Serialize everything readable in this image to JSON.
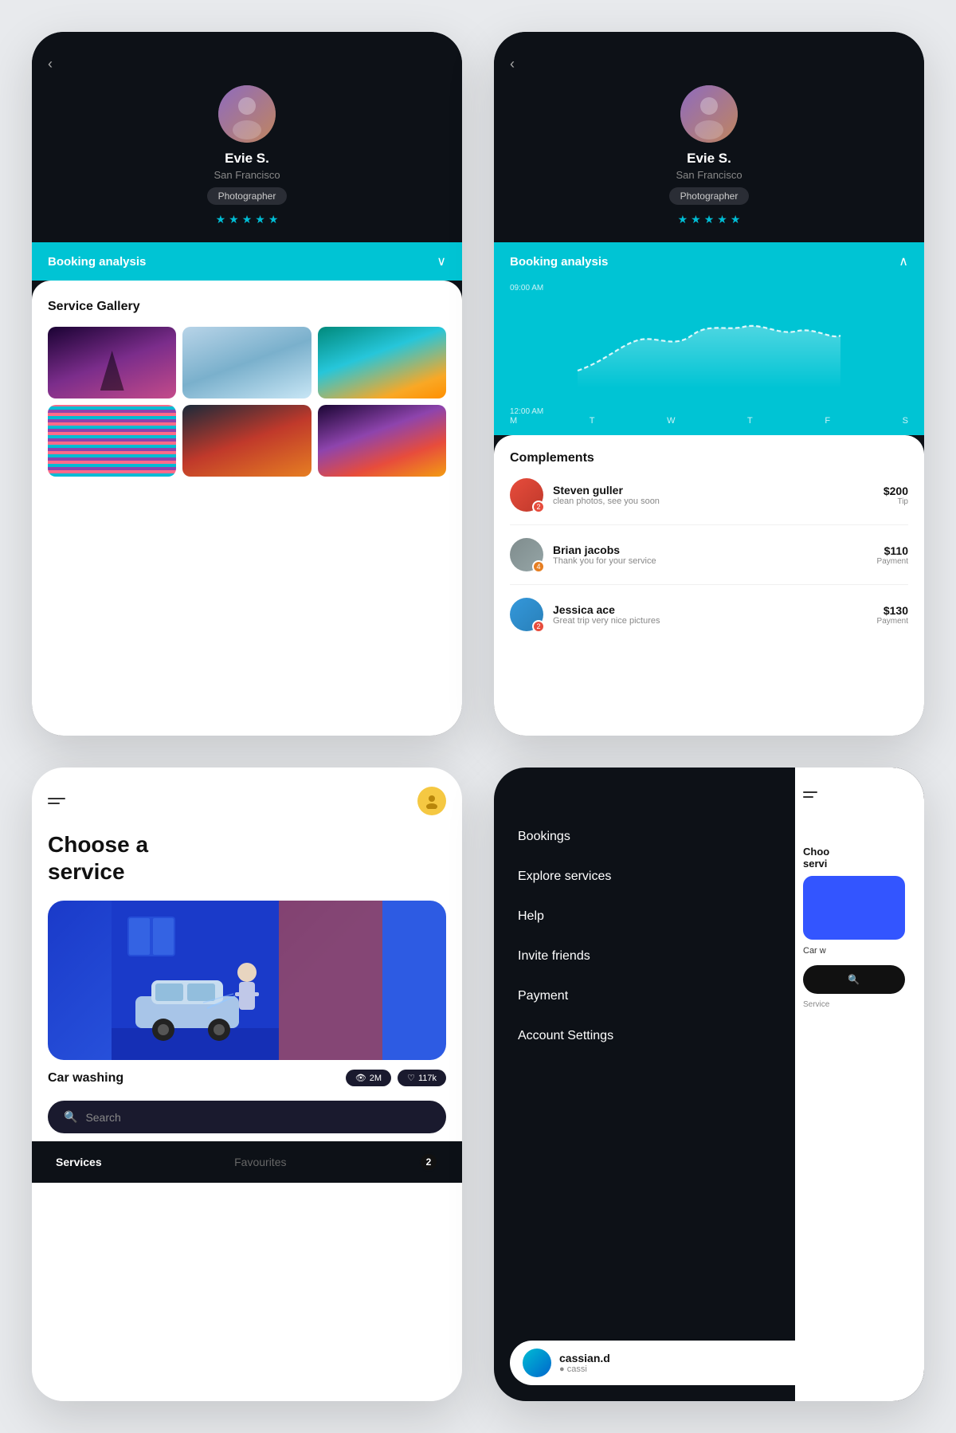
{
  "topLeft": {
    "back": "‹",
    "name": "Evie S.",
    "city": "San Francisco",
    "badge": "Photographer",
    "stars": [
      "★",
      "★",
      "★",
      "★",
      "★"
    ],
    "bookingBar": "Booking analysis",
    "chevron": "∨",
    "galleryTitle": "Service Gallery",
    "images": [
      "img1",
      "img2",
      "img3",
      "img4",
      "img5",
      "img6"
    ]
  },
  "topRight": {
    "back": "‹",
    "name": "Evie S.",
    "city": "San Francisco",
    "badge": "Photographer",
    "stars": [
      "★",
      "★",
      "★",
      "★",
      "★"
    ],
    "bookingBar": "Booking analysis",
    "chevron": "∧",
    "timeTop": "09:00 AM",
    "timeBottom": "12:00 AM",
    "days": [
      "M",
      "T",
      "W",
      "T",
      "F",
      "S"
    ],
    "complementsTitle": "Complements",
    "complements": [
      {
        "name": "Steven guller",
        "msg": "clean photos, see you soon",
        "amount": "$200",
        "type": "Tip",
        "badge": "2"
      },
      {
        "name": "Brian jacobs",
        "msg": "Thank you for your service",
        "amount": "$110",
        "type": "Payment",
        "badge": "4"
      },
      {
        "name": "Jessica ace",
        "msg": "Great trip very nice pictures",
        "amount": "$130",
        "type": "Payment",
        "badge": "2"
      }
    ]
  },
  "bottomLeft": {
    "menuIcon": "≡",
    "chooseTitle": "Choose a\nservice",
    "serviceName": "Car washing",
    "stats": [
      {
        "icon": "👁",
        "value": "2M"
      },
      {
        "icon": "♡",
        "value": "117k"
      }
    ],
    "searchPlaceholder": "Search",
    "navItems": [
      {
        "label": "Services",
        "active": true
      },
      {
        "label": "Favourites",
        "active": false
      }
    ],
    "navBadge": "2"
  },
  "bottomRight": {
    "menuIcon": "≡",
    "menuItems": [
      "Bookings",
      "Explore services",
      "Help",
      "Invite friends",
      "Payment",
      "Account Settings"
    ],
    "user": {
      "username": "cassian.d",
      "usertag": "● cassi"
    },
    "logoutIcon": "→",
    "peekTitle": "Choo\nservi",
    "peekCarwash": "Car w",
    "peekServicesLabel": "Service"
  }
}
